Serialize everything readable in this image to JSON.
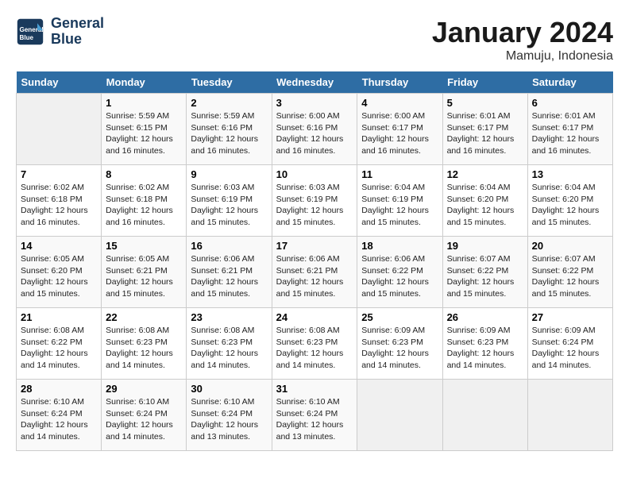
{
  "header": {
    "logo_line1": "General",
    "logo_line2": "Blue",
    "month_year": "January 2024",
    "location": "Mamuju, Indonesia"
  },
  "columns": [
    "Sunday",
    "Monday",
    "Tuesday",
    "Wednesday",
    "Thursday",
    "Friday",
    "Saturday"
  ],
  "weeks": [
    [
      {
        "day": "",
        "sunrise": "",
        "sunset": "",
        "daylight": ""
      },
      {
        "day": "1",
        "sunrise": "Sunrise: 5:59 AM",
        "sunset": "Sunset: 6:15 PM",
        "daylight": "Daylight: 12 hours and 16 minutes."
      },
      {
        "day": "2",
        "sunrise": "Sunrise: 5:59 AM",
        "sunset": "Sunset: 6:16 PM",
        "daylight": "Daylight: 12 hours and 16 minutes."
      },
      {
        "day": "3",
        "sunrise": "Sunrise: 6:00 AM",
        "sunset": "Sunset: 6:16 PM",
        "daylight": "Daylight: 12 hours and 16 minutes."
      },
      {
        "day": "4",
        "sunrise": "Sunrise: 6:00 AM",
        "sunset": "Sunset: 6:17 PM",
        "daylight": "Daylight: 12 hours and 16 minutes."
      },
      {
        "day": "5",
        "sunrise": "Sunrise: 6:01 AM",
        "sunset": "Sunset: 6:17 PM",
        "daylight": "Daylight: 12 hours and 16 minutes."
      },
      {
        "day": "6",
        "sunrise": "Sunrise: 6:01 AM",
        "sunset": "Sunset: 6:17 PM",
        "daylight": "Daylight: 12 hours and 16 minutes."
      }
    ],
    [
      {
        "day": "7",
        "sunrise": "Sunrise: 6:02 AM",
        "sunset": "Sunset: 6:18 PM",
        "daylight": "Daylight: 12 hours and 16 minutes."
      },
      {
        "day": "8",
        "sunrise": "Sunrise: 6:02 AM",
        "sunset": "Sunset: 6:18 PM",
        "daylight": "Daylight: 12 hours and 16 minutes."
      },
      {
        "day": "9",
        "sunrise": "Sunrise: 6:03 AM",
        "sunset": "Sunset: 6:19 PM",
        "daylight": "Daylight: 12 hours and 15 minutes."
      },
      {
        "day": "10",
        "sunrise": "Sunrise: 6:03 AM",
        "sunset": "Sunset: 6:19 PM",
        "daylight": "Daylight: 12 hours and 15 minutes."
      },
      {
        "day": "11",
        "sunrise": "Sunrise: 6:04 AM",
        "sunset": "Sunset: 6:19 PM",
        "daylight": "Daylight: 12 hours and 15 minutes."
      },
      {
        "day": "12",
        "sunrise": "Sunrise: 6:04 AM",
        "sunset": "Sunset: 6:20 PM",
        "daylight": "Daylight: 12 hours and 15 minutes."
      },
      {
        "day": "13",
        "sunrise": "Sunrise: 6:04 AM",
        "sunset": "Sunset: 6:20 PM",
        "daylight": "Daylight: 12 hours and 15 minutes."
      }
    ],
    [
      {
        "day": "14",
        "sunrise": "Sunrise: 6:05 AM",
        "sunset": "Sunset: 6:20 PM",
        "daylight": "Daylight: 12 hours and 15 minutes."
      },
      {
        "day": "15",
        "sunrise": "Sunrise: 6:05 AM",
        "sunset": "Sunset: 6:21 PM",
        "daylight": "Daylight: 12 hours and 15 minutes."
      },
      {
        "day": "16",
        "sunrise": "Sunrise: 6:06 AM",
        "sunset": "Sunset: 6:21 PM",
        "daylight": "Daylight: 12 hours and 15 minutes."
      },
      {
        "day": "17",
        "sunrise": "Sunrise: 6:06 AM",
        "sunset": "Sunset: 6:21 PM",
        "daylight": "Daylight: 12 hours and 15 minutes."
      },
      {
        "day": "18",
        "sunrise": "Sunrise: 6:06 AM",
        "sunset": "Sunset: 6:22 PM",
        "daylight": "Daylight: 12 hours and 15 minutes."
      },
      {
        "day": "19",
        "sunrise": "Sunrise: 6:07 AM",
        "sunset": "Sunset: 6:22 PM",
        "daylight": "Daylight: 12 hours and 15 minutes."
      },
      {
        "day": "20",
        "sunrise": "Sunrise: 6:07 AM",
        "sunset": "Sunset: 6:22 PM",
        "daylight": "Daylight: 12 hours and 15 minutes."
      }
    ],
    [
      {
        "day": "21",
        "sunrise": "Sunrise: 6:08 AM",
        "sunset": "Sunset: 6:22 PM",
        "daylight": "Daylight: 12 hours and 14 minutes."
      },
      {
        "day": "22",
        "sunrise": "Sunrise: 6:08 AM",
        "sunset": "Sunset: 6:23 PM",
        "daylight": "Daylight: 12 hours and 14 minutes."
      },
      {
        "day": "23",
        "sunrise": "Sunrise: 6:08 AM",
        "sunset": "Sunset: 6:23 PM",
        "daylight": "Daylight: 12 hours and 14 minutes."
      },
      {
        "day": "24",
        "sunrise": "Sunrise: 6:08 AM",
        "sunset": "Sunset: 6:23 PM",
        "daylight": "Daylight: 12 hours and 14 minutes."
      },
      {
        "day": "25",
        "sunrise": "Sunrise: 6:09 AM",
        "sunset": "Sunset: 6:23 PM",
        "daylight": "Daylight: 12 hours and 14 minutes."
      },
      {
        "day": "26",
        "sunrise": "Sunrise: 6:09 AM",
        "sunset": "Sunset: 6:23 PM",
        "daylight": "Daylight: 12 hours and 14 minutes."
      },
      {
        "day": "27",
        "sunrise": "Sunrise: 6:09 AM",
        "sunset": "Sunset: 6:24 PM",
        "daylight": "Daylight: 12 hours and 14 minutes."
      }
    ],
    [
      {
        "day": "28",
        "sunrise": "Sunrise: 6:10 AM",
        "sunset": "Sunset: 6:24 PM",
        "daylight": "Daylight: 12 hours and 14 minutes."
      },
      {
        "day": "29",
        "sunrise": "Sunrise: 6:10 AM",
        "sunset": "Sunset: 6:24 PM",
        "daylight": "Daylight: 12 hours and 14 minutes."
      },
      {
        "day": "30",
        "sunrise": "Sunrise: 6:10 AM",
        "sunset": "Sunset: 6:24 PM",
        "daylight": "Daylight: 12 hours and 13 minutes."
      },
      {
        "day": "31",
        "sunrise": "Sunrise: 6:10 AM",
        "sunset": "Sunset: 6:24 PM",
        "daylight": "Daylight: 12 hours and 13 minutes."
      },
      {
        "day": "",
        "sunrise": "",
        "sunset": "",
        "daylight": ""
      },
      {
        "day": "",
        "sunrise": "",
        "sunset": "",
        "daylight": ""
      },
      {
        "day": "",
        "sunrise": "",
        "sunset": "",
        "daylight": ""
      }
    ]
  ]
}
